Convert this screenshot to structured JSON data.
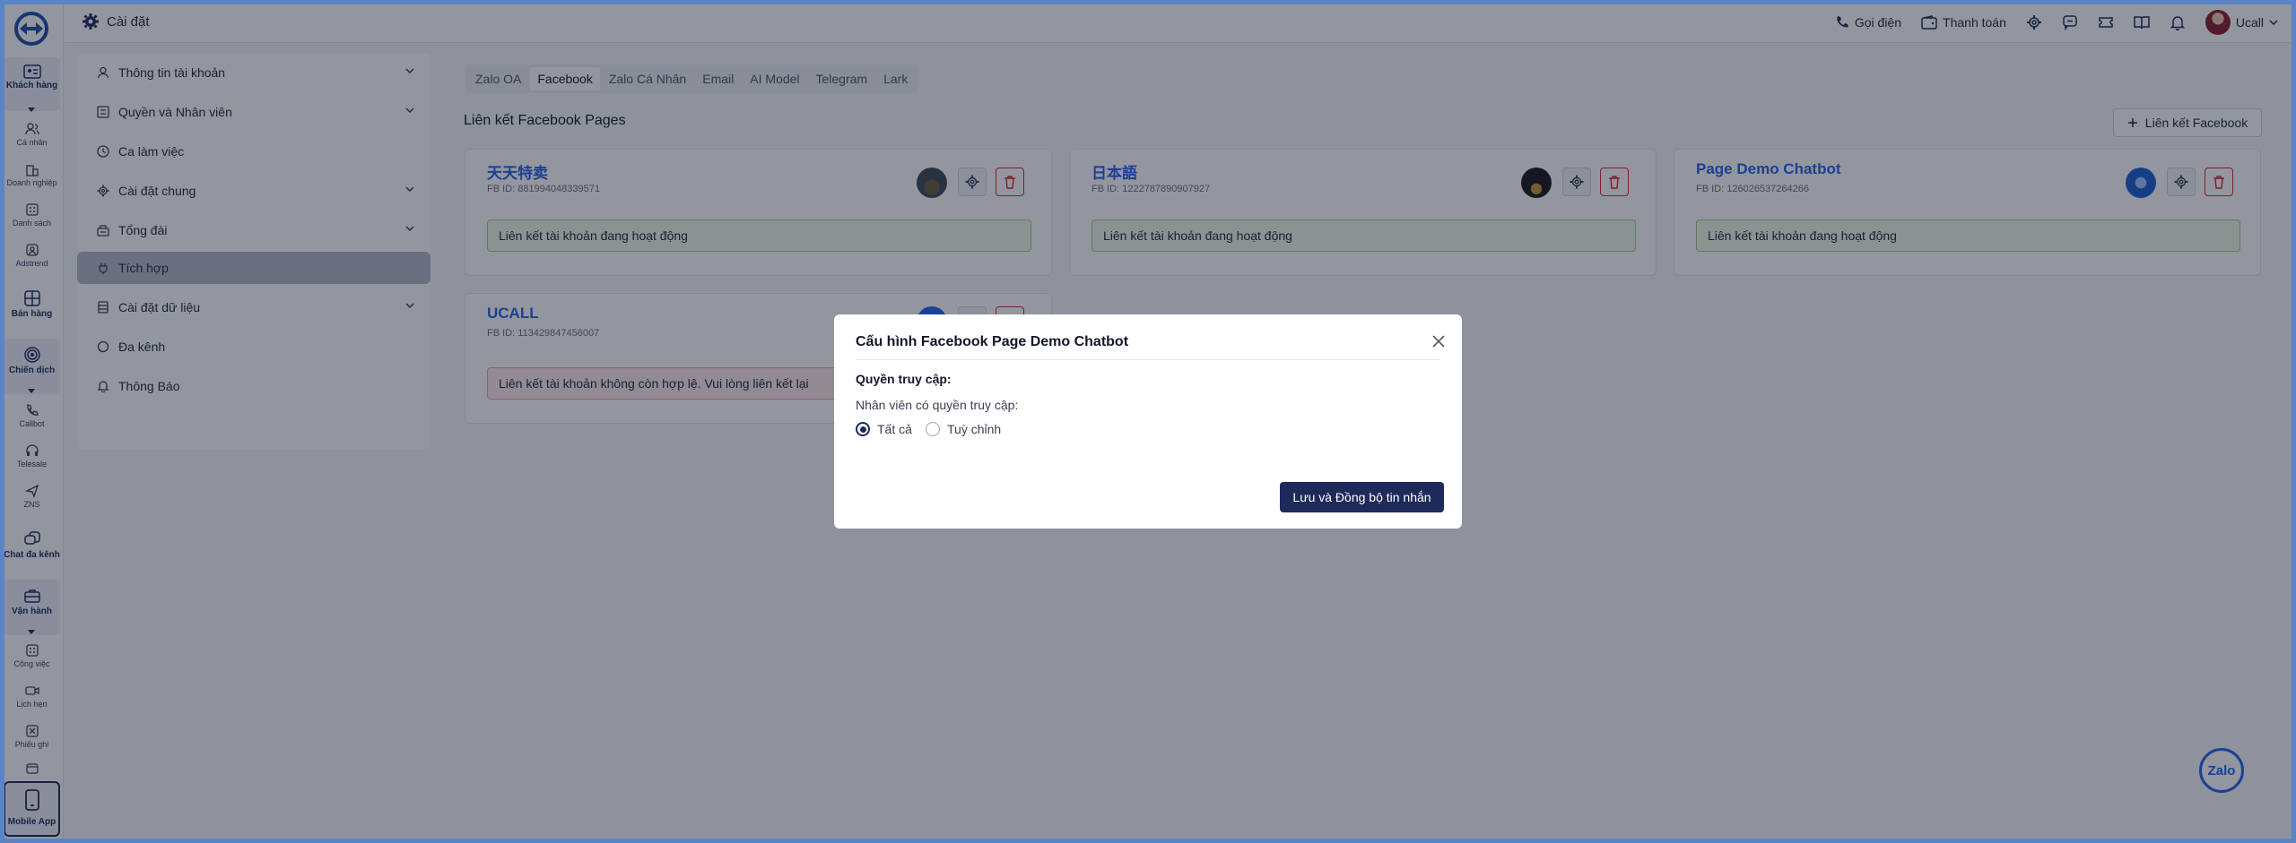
{
  "topbar": {
    "title": "Cài đặt",
    "call_label": "Gọi điện",
    "payment_label": "Thanh toán",
    "user_name": "Ucall"
  },
  "rail": {
    "items": [
      {
        "label": "Khách hàng",
        "icon": "id-card-icon"
      },
      {
        "label": "Cá nhân",
        "icon": "users-icon"
      },
      {
        "label": "Doanh nghiệp",
        "icon": "building-icon"
      },
      {
        "label": "Danh sách",
        "icon": "grid-icon"
      },
      {
        "label": "Adstrend",
        "icon": "user-circle-icon"
      },
      {
        "label": "Bán hàng",
        "icon": "layout-icon"
      },
      {
        "label": "Chiến dịch",
        "icon": "broadcast-icon"
      },
      {
        "label": "Callbot",
        "icon": "phone-icon"
      },
      {
        "label": "Telesale",
        "icon": "headset-icon"
      },
      {
        "label": "ZNS",
        "icon": "send-icon"
      },
      {
        "label": "Chat đa kênh",
        "icon": "chat-icon"
      },
      {
        "label": "Vận hành",
        "icon": "briefcase-icon"
      },
      {
        "label": "Công việc",
        "icon": "tasks-icon"
      },
      {
        "label": "Lịch hẹn",
        "icon": "video-icon"
      },
      {
        "label": "Phiếu ghi",
        "icon": "ticket-icon"
      },
      {
        "label": "Mobile App",
        "icon": "mobile-icon"
      }
    ]
  },
  "settings_nav": [
    {
      "label": "Thông tin tài khoản",
      "icon": "user-icon",
      "expandable": true
    },
    {
      "label": "Quyền và Nhân viên",
      "icon": "list-icon",
      "expandable": true
    },
    {
      "label": "Ca làm việc",
      "icon": "clock-icon",
      "expandable": false
    },
    {
      "label": "Cài đặt chung",
      "icon": "gear-icon",
      "expandable": true
    },
    {
      "label": "Tổng đài",
      "icon": "switchboard-icon",
      "expandable": true
    },
    {
      "label": "Tích hợp",
      "icon": "plug-icon",
      "expandable": false,
      "active": true
    },
    {
      "label": "Cài đặt dữ liệu",
      "icon": "database-icon",
      "expandable": true
    },
    {
      "label": "Đa kênh",
      "icon": "message-icon",
      "expandable": false
    },
    {
      "label": "Thông Báo",
      "icon": "bell-icon",
      "expandable": false
    }
  ],
  "tabs": [
    "Zalo OA",
    "Facebook",
    "Zalo Cá Nhân",
    "Email",
    "AI Model",
    "Telegram",
    "Lark"
  ],
  "active_tab": "Facebook",
  "section_title": "Liên kết Facebook Pages",
  "add_button_label": "Liên kết Facebook",
  "pages": [
    {
      "name": "天天特卖",
      "fb_id": "FB ID: 881994048339571",
      "status": "Liên kết tài khoản đang hoạt động",
      "status_type": "ok"
    },
    {
      "name": "日本語",
      "fb_id": "FB ID: 1222787890907927",
      "status": "Liên kết tài khoản đang hoạt động",
      "status_type": "ok"
    },
    {
      "name": "Page Demo Chatbot",
      "fb_id": "FB ID: 126026537264266",
      "status": "Liên kết tài khoản đang hoạt động",
      "status_type": "ok"
    },
    {
      "name": "UCALL",
      "fb_id": "FB ID: 113429847456007",
      "status": "Liên kết tài khoản không còn hợp lệ. Vui lòng liên kết lại",
      "status_type": "bad"
    }
  ],
  "zalo_fab_label": "Zalo",
  "modal": {
    "title": "Cấu hình Facebook Page Demo Chatbot",
    "access_heading": "Quyền truy cập:",
    "access_label": "Nhân viên có quyền truy cập:",
    "options": [
      "Tất cả",
      "Tuỳ chỉnh"
    ],
    "selected_option": "Tất cả",
    "save_label": "Lưu và Đồng bộ tin nhắn"
  }
}
